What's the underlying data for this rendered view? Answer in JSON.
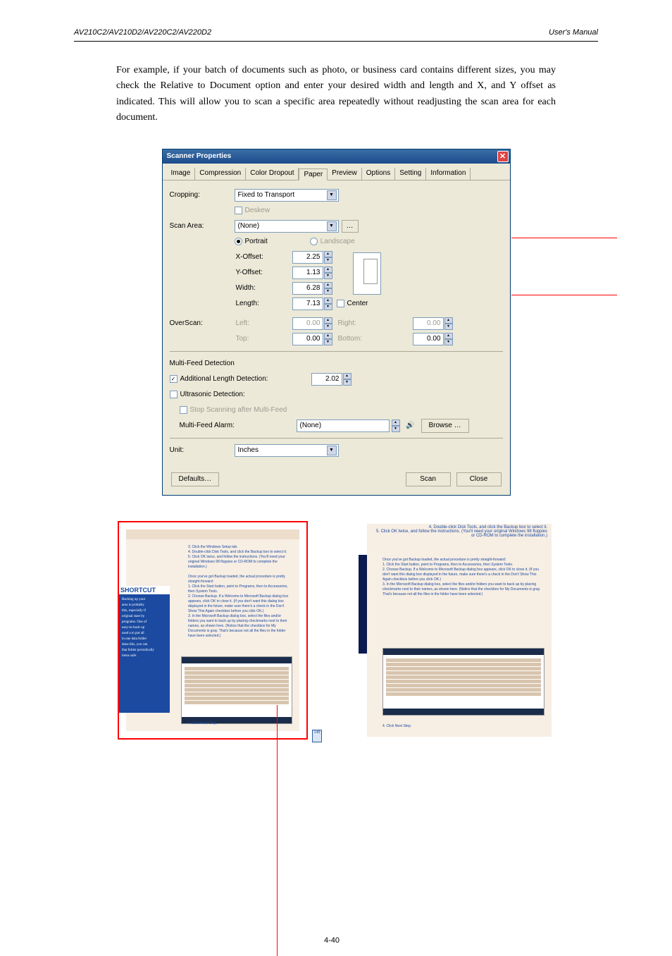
{
  "header": {
    "left": "AV210C2/AV210D2/AV220C2/AV220D2",
    "right": "User's Manual"
  },
  "para": "For example, if your batch of documents such as photo, or business card contains different sizes, you may check the Relative to Document option and enter your desired width and length and X, and Y offset as indicated. This will allow you to scan a specific area repeatedly without readjusting the scan area for each document.",
  "dialog": {
    "title": "Scanner Properties",
    "tabs": [
      "Image",
      "Compression",
      "Color Dropout",
      "Paper",
      "Preview",
      "Options",
      "Setting",
      "Information"
    ],
    "active_tab": "Paper",
    "cropping_label": "Cropping:",
    "cropping_value": "Fixed to Transport",
    "deskew_label": "Deskew",
    "scanarea_label": "Scan Area:",
    "scanarea_value": "(None)",
    "scanarea_more": "…",
    "portrait": "Portrait",
    "landscape": "Landscape",
    "xoffset_label": "X-Offset:",
    "xoffset_val": "2.25",
    "yoffset_label": "Y-Offset:",
    "yoffset_val": "1.13",
    "width_label": "Width:",
    "width_val": "6.28",
    "length_label": "Length:",
    "length_val": "7.13",
    "center_label": "Center",
    "overscan_label": "OverScan:",
    "os_left": "Left:",
    "os_left_v": "0.00",
    "os_right": "Right:",
    "os_right_v": "0.00",
    "os_top": "Top:",
    "os_top_v": "0.00",
    "os_bottom": "Bottom:",
    "os_bottom_v": "0.00",
    "mf_label": "Multi-Feed Detection",
    "mf_add": "Additional Length Detection:",
    "mf_add_v": "2.02",
    "mf_ultra": "Ultrasonic Detection:",
    "mf_stop": "Stop Scanning after Multi-Feed",
    "mf_alarm": "Multi-Feed Alarm:",
    "mf_alarm_v": "(None)",
    "browse": "Browse …",
    "unit_label": "Unit:",
    "unit_value": "Inches",
    "defaults": "Defaults…",
    "scan": "Scan",
    "close": "Close"
  },
  "footer_page": "4-40"
}
